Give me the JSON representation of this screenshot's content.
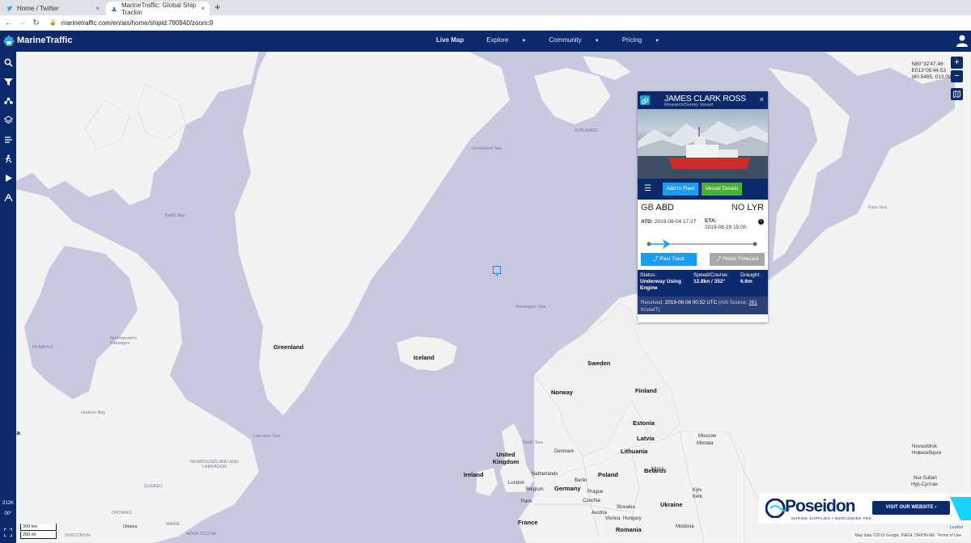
{
  "browser": {
    "tabs": [
      {
        "label": "Home / Twitter",
        "close": "×"
      },
      {
        "label": "MarineTraffic: Global Ship Trackin",
        "close": "×"
      }
    ],
    "new_tab": "+",
    "url": "marinetraffic.com/en/ais/home/shipid:780940/zoom:9"
  },
  "header": {
    "logo_text": "MarineTraffic",
    "nav": [
      "Live Map",
      "Explore",
      "Community",
      "Pricing"
    ]
  },
  "sidebar": {
    "items": [
      "search-icon",
      "filter-icon",
      "network-icon",
      "layers-icon",
      "weather-icon",
      "vessel-icon",
      "play-icon",
      "measure-icon"
    ],
    "counter": "212K",
    "counter_sub": "00°"
  },
  "map": {
    "coords": [
      "N80°32'47.46",
      "E013°05'44.53",
      "(80.5465, 013.0957)"
    ],
    "zoom_in": "+",
    "zoom_out": "−",
    "bold_labels": [
      "Greenland",
      "Iceland",
      "Sweden",
      "Norway",
      "Finland",
      "United Kingdom",
      "Ireland",
      "Poland",
      "Germany",
      "Belarus",
      "Ukraine",
      "Lithuania",
      "Latvia",
      "Estonia",
      "Romania",
      "France",
      "Denmark",
      "Netherlands",
      "Czechia",
      "Slovakia",
      "Austria",
      "Hungary",
      "Belgium",
      "Moldova"
    ],
    "sea_labels": [
      "Greenland Sea",
      "Baffin Bay",
      "Norwegian Sea",
      "Labrador Sea",
      "Hudson Bay",
      "Kara Sea",
      "North Sea",
      "SVALBARD"
    ],
    "place_labels": [
      "NUNAVUT",
      "Northwestern Passages",
      "NEWFOUNDLAND AND LABRADOR",
      "QUEBEC",
      "ONTARIO",
      "Ottawa",
      "MAINE",
      "NOVA SCOTIA",
      "WISCONSIN",
      "Moscow",
      "Москва",
      "Novosibirsk",
      "Новосибирск",
      "Nur-Sultan",
      "Нур-Султан",
      "London",
      "Paris",
      "Berlin",
      "Prague",
      "Vienna",
      "Kyiv",
      "Київ",
      "Minsk",
      "da"
    ],
    "scale": [
      "300 km",
      "200 mi"
    ],
    "attribution": "Map data ©2019 Google, INEGI, ORION-ME",
    "terms": "Terms of Use",
    "leaflet": "Leaflet"
  },
  "vessel": {
    "name": "JAMES CLARK ROSS",
    "type": "Research/Survey Vessel",
    "close": "×",
    "buttons": {
      "add_fleet": "Add to Fleet",
      "details": "Vessel Details"
    },
    "departure": {
      "country": "GB",
      "port": "ABD"
    },
    "arrival": {
      "country": "NO",
      "port": "LYR"
    },
    "atd_label": "ATD:",
    "atd": "2019-08-04 17:27",
    "eta_label": "ETA:",
    "eta": "2019-08-29 15:00",
    "progress": 0.15,
    "past_track": "Past Track",
    "route_forecast": "Route Forecast",
    "status_label": "Status:",
    "status": "Underway Using Engine",
    "speed_label": "Speed/Course:",
    "speed": "12.8kn / 352°",
    "draught_label": "Draught:",
    "draught": "6.6m",
    "received_label": "Received:",
    "received": "2019-08-08 00:52 UTC",
    "ais_source_pre": "(AIS Source:",
    "ais_source_id": "261",
    "ais_source_post": "KnowIT)"
  },
  "ad": {
    "logo": "Poseidon",
    "tagline": "MARINE SUPPLIES • WORLDWIDE FRS",
    "cta": "VISIT OUR WEBSITE ›"
  },
  "colors": {
    "brand": "#0c2a6b",
    "sea": "#c8c8de",
    "land": "#f4f4f4",
    "button_blue": "#1b9df0",
    "button_green": "#4caf32"
  }
}
